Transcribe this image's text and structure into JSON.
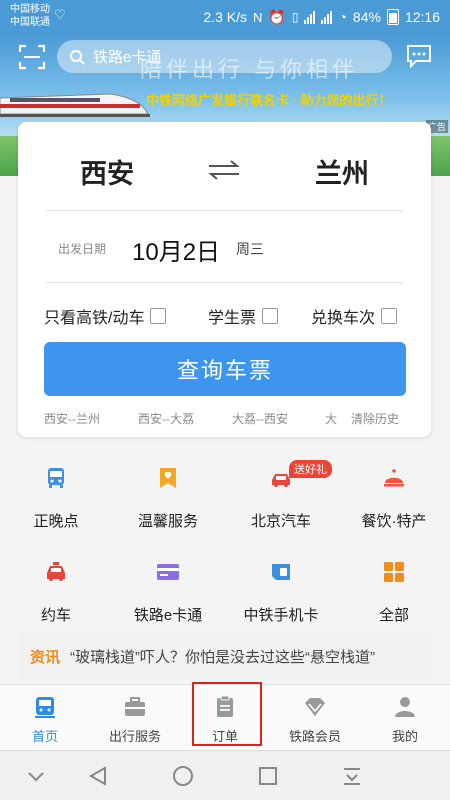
{
  "status_bar": {
    "carrier_1": "中国移动",
    "carrier_2": "中国联通",
    "speed": "2.3 K/s",
    "battery": "84%",
    "time": "12:16"
  },
  "banner": {
    "slogan": "陪伴出行 与你相伴",
    "ad_text": "中铁网络广发银行联名卡 · 助力您的出行！",
    "ad_tag": "广告"
  },
  "search": {
    "placeholder": "铁路e卡通"
  },
  "ticket": {
    "from": "西安",
    "to": "兰州",
    "date_label": "出发日期",
    "date": "10月2日",
    "weekday": "周三",
    "options": [
      "只看高铁/动车",
      "学生票",
      "兑换车次"
    ],
    "query_button": "查询车票",
    "history": [
      "西安--兰州",
      "西安--大荔",
      "大荔--西安",
      "大"
    ],
    "clear_history": "清除历史"
  },
  "services": [
    {
      "label": "正晚点",
      "icon": "bus-icon",
      "color": "#3d8fe0"
    },
    {
      "label": "温馨服务",
      "icon": "heart-tag-icon",
      "color": "#f5a623"
    },
    {
      "label": "北京汽车",
      "icon": "car-icon",
      "color": "#e8453c",
      "badge": "送好礼"
    },
    {
      "label": "餐饮·特产",
      "icon": "dining-icon",
      "color": "#f0563a"
    },
    {
      "label": "约车",
      "icon": "taxi-icon",
      "color": "#e8453c"
    },
    {
      "label": "铁路e卡通",
      "icon": "card-icon",
      "color": "#8b6ee8"
    },
    {
      "label": "中铁手机卡",
      "icon": "sim-card-icon",
      "color": "#3d8fe0"
    },
    {
      "label": "全部",
      "icon": "grid-icon",
      "color": "#f08c1a"
    }
  ],
  "news": {
    "tag": "资讯",
    "text": "“玻璃栈道”吓人？你怕是没去过这些“悬空栈道”"
  },
  "tabs": [
    {
      "label": "首页",
      "icon": "home-icon",
      "active": true
    },
    {
      "label": "出行服务",
      "icon": "briefcase-icon",
      "active": false
    },
    {
      "label": "订单",
      "icon": "order-icon",
      "active": false
    },
    {
      "label": "铁路会员",
      "icon": "diamond-icon",
      "active": false
    },
    {
      "label": "我的",
      "icon": "user-icon",
      "active": false
    }
  ]
}
